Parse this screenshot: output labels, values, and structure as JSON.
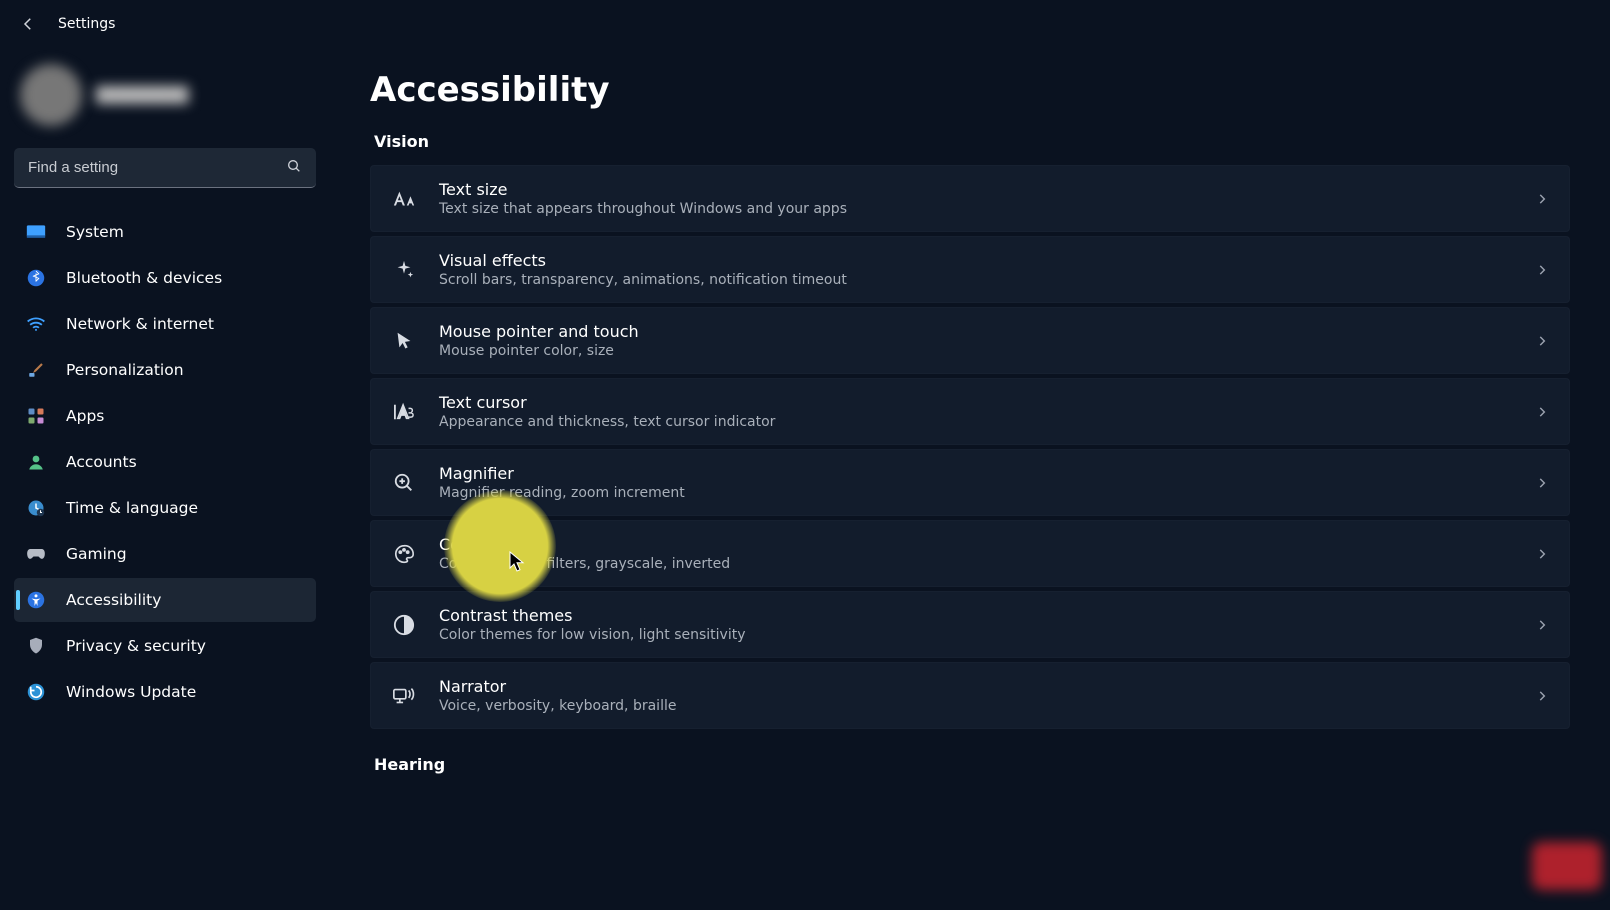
{
  "app": {
    "title": "Settings"
  },
  "search": {
    "placeholder": "Find a setting"
  },
  "nav": {
    "items": [
      {
        "label": "System"
      },
      {
        "label": "Bluetooth & devices"
      },
      {
        "label": "Network & internet"
      },
      {
        "label": "Personalization"
      },
      {
        "label": "Apps"
      },
      {
        "label": "Accounts"
      },
      {
        "label": "Time & language"
      },
      {
        "label": "Gaming"
      },
      {
        "label": "Accessibility"
      },
      {
        "label": "Privacy & security"
      },
      {
        "label": "Windows Update"
      }
    ]
  },
  "page": {
    "title": "Accessibility",
    "sections": {
      "vision": "Vision",
      "hearing": "Hearing"
    },
    "cards": [
      {
        "title": "Text size",
        "sub": "Text size that appears throughout Windows and your apps"
      },
      {
        "title": "Visual effects",
        "sub": "Scroll bars, transparency, animations, notification timeout"
      },
      {
        "title": "Mouse pointer and touch",
        "sub": "Mouse pointer color, size"
      },
      {
        "title": "Text cursor",
        "sub": "Appearance and thickness, text cursor indicator"
      },
      {
        "title": "Magnifier",
        "sub": "Magnifier reading, zoom increment"
      },
      {
        "title": "Color filters",
        "sub": "Colorblindness filters, grayscale, inverted"
      },
      {
        "title": "Contrast themes",
        "sub": "Color themes for low vision, light sensitivity"
      },
      {
        "title": "Narrator",
        "sub": "Voice, verbosity, keyboard, braille"
      }
    ]
  }
}
